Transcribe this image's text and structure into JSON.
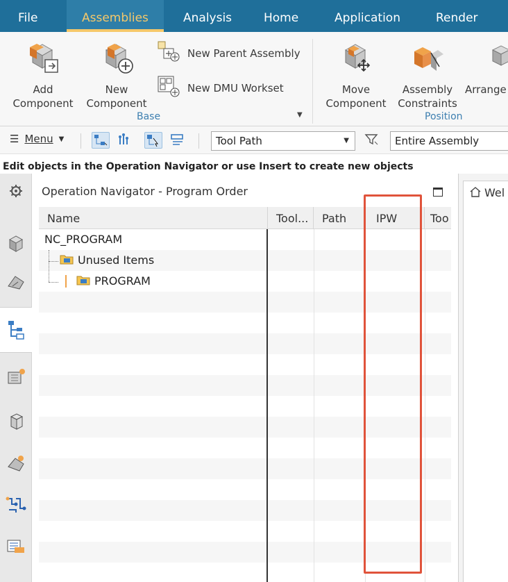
{
  "tabs": [
    {
      "label": "File",
      "active": false
    },
    {
      "label": "Assemblies",
      "active": true
    },
    {
      "label": "Analysis",
      "active": false
    },
    {
      "label": "Home",
      "active": false
    },
    {
      "label": "Application",
      "active": false
    },
    {
      "label": "Render",
      "active": false
    }
  ],
  "ribbon": {
    "add_component": {
      "line1": "Add",
      "line2": "Component"
    },
    "new_component": {
      "line1": "New",
      "line2": "Component"
    },
    "new_parent_assembly": "New Parent Assembly",
    "new_dmu_workset": "New DMU Workset",
    "base_group": "Base",
    "move_component": {
      "line1": "Move",
      "line2": "Component"
    },
    "assembly_constraints": {
      "line1": "Assembly",
      "line2": "Constraints"
    },
    "arrange": "Arrange",
    "position_group": "Position"
  },
  "toolbar": {
    "menu_label": "Menu",
    "menu_underline_char": "M",
    "filter_value": "Tool Path",
    "scope_value": "Entire Assembly"
  },
  "status_text": "Edit objects in the Operation Navigator or use Insert to create new objects",
  "navigator": {
    "title": "Operation Navigator - Program Order",
    "columns": [
      "Name",
      "Tool...",
      "Path",
      "IPW",
      "Too"
    ],
    "rows": [
      {
        "name": "NC_PROGRAM",
        "level": 0
      },
      {
        "name": "Unused Items",
        "level": 1
      },
      {
        "name": "PROGRAM",
        "level": 1
      }
    ]
  },
  "right_panel": {
    "tab_label": "Wel"
  },
  "colors": {
    "tabbar": "#1f6f9a",
    "active_tab_text": "#f5c86a",
    "group_label": "#3d7fb0",
    "highlight": "#e0533b"
  }
}
